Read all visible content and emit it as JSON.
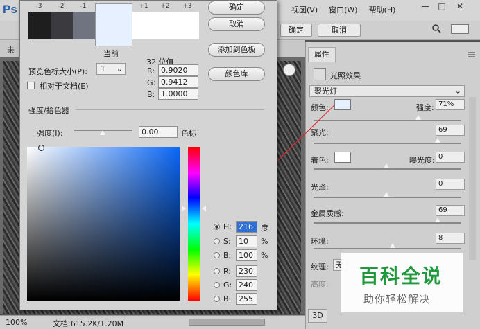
{
  "app": {
    "logo": "Ps"
  },
  "menu": [
    "视图(V)",
    "窗口(W)",
    "帮助(H)"
  ],
  "window_controls": [
    "—",
    "□",
    "✕"
  ],
  "optbar": {
    "ok": "确定",
    "cancel": "取消"
  },
  "doc_tab": "未",
  "status": {
    "zoom": "100%",
    "doc": "文档:615.2K/1.20M"
  },
  "properties": {
    "tab": "属性",
    "section": "光照效果",
    "preset": "聚光灯",
    "color_label": "颜色:",
    "color_value": "#e6f0ff",
    "intensity_label": "强度:",
    "intensity_value": "71%",
    "intensity": 71,
    "hotspot_label": "聚光:",
    "hotspot_value": "69",
    "colorize_label": "着色:",
    "exposure_label": "曝光度:",
    "exposure_value": "0",
    "gloss_label": "光泽:",
    "gloss_value": "0",
    "metallic_label": "金属质感:",
    "metallic_value": "69",
    "ambience_label": "环境:",
    "ambience_value": "8",
    "texture_label": "纹理:",
    "texture_value": "无",
    "height_label": "高度:",
    "bottom_tab": "3D"
  },
  "dialog": {
    "ok": "确定",
    "cancel": "取消",
    "add_swatch": "添加到色板",
    "color_library": "颜色库",
    "ticks": [
      "-3",
      "-2",
      "-1",
      "+1",
      "+2",
      "+3"
    ],
    "current_label": "当前",
    "preview_size_label": "预览色标大小(P):",
    "preview_size_value": "1",
    "relative_doc_label": "相对于文档(E)",
    "bits_label": "32 位值",
    "r_float_label": "R:",
    "r_float": "0.9020",
    "g_float_label": "G:",
    "g_float": "0.9412",
    "b_float_label": "B:",
    "b_float": "1.0000",
    "section_title": "强度/拾色器",
    "intensity_label": "强度(I):",
    "intensity_value": "0.00",
    "intensity_unit": "色标",
    "h_label": "H:",
    "h_value": "216",
    "h_unit": "度",
    "s_label": "S:",
    "s_value": "10",
    "s_unit": "%",
    "b_label": "B:",
    "b_value": "100",
    "b_unit": "%",
    "r_label": "R:",
    "r_value": "230",
    "g_label": "G:",
    "g_value": "240",
    "bb_label": "B:",
    "bb_value": "255"
  },
  "watermark": {
    "title": "百科全说",
    "subtitle": "助你轻松解决"
  },
  "colors": {
    "arrow": "#e02a2a",
    "current_color": "#e6f0ff",
    "accent": "#2a5ea6",
    "watermark_green": "#1e9a3c"
  }
}
